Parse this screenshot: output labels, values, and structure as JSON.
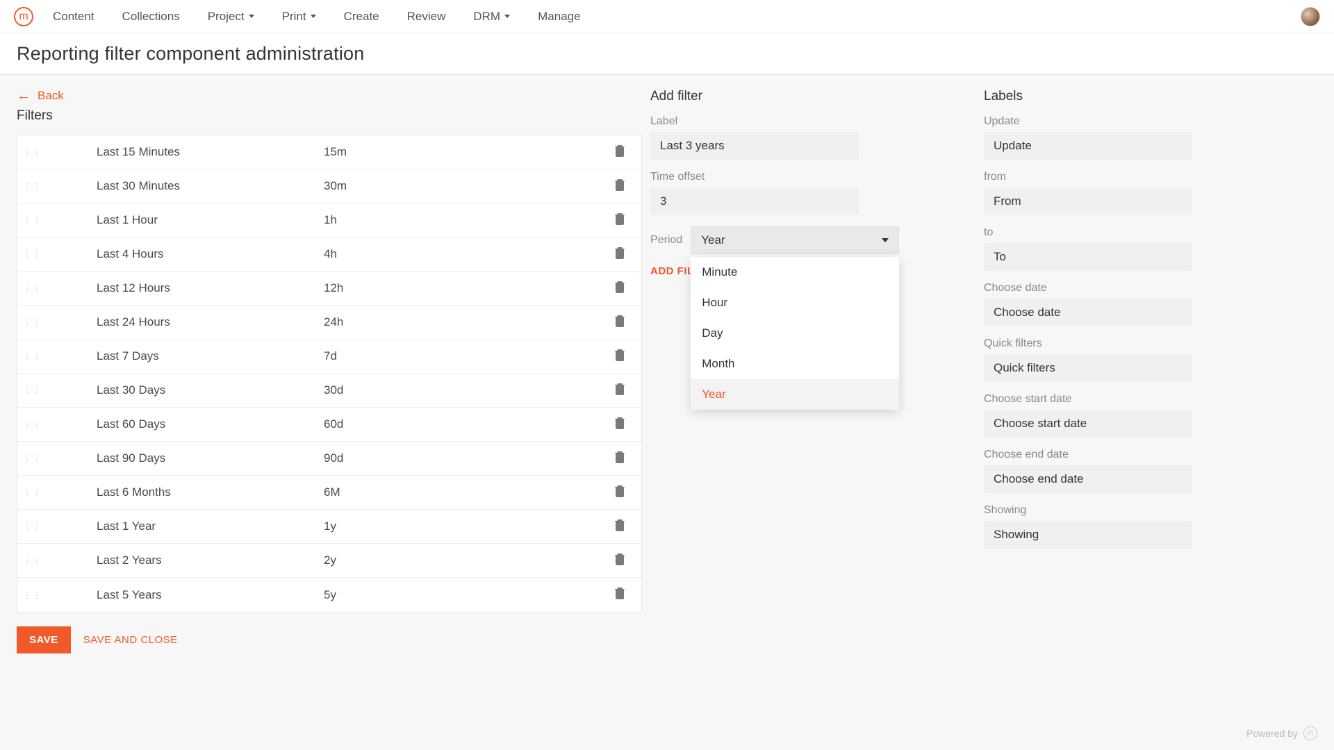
{
  "logo_letter": "m",
  "nav": [
    {
      "label": "Content",
      "caret": false
    },
    {
      "label": "Collections",
      "caret": false
    },
    {
      "label": "Project",
      "caret": true
    },
    {
      "label": "Print",
      "caret": true
    },
    {
      "label": "Create",
      "caret": false
    },
    {
      "label": "Review",
      "caret": false
    },
    {
      "label": "DRM",
      "caret": true
    },
    {
      "label": "Manage",
      "caret": false
    }
  ],
  "page_title": "Reporting filter component administration",
  "back_label": "Back",
  "filters_heading": "Filters",
  "filters": [
    {
      "label": "Last 15 Minutes",
      "code": "15m"
    },
    {
      "label": "Last 30 Minutes",
      "code": "30m"
    },
    {
      "label": "Last 1 Hour",
      "code": "1h"
    },
    {
      "label": "Last 4 Hours",
      "code": "4h"
    },
    {
      "label": "Last 12 Hours",
      "code": "12h"
    },
    {
      "label": "Last 24 Hours",
      "code": "24h"
    },
    {
      "label": "Last 7 Days",
      "code": "7d"
    },
    {
      "label": "Last 30 Days",
      "code": "30d"
    },
    {
      "label": "Last 60 Days",
      "code": "60d"
    },
    {
      "label": "Last 90 Days",
      "code": "90d"
    },
    {
      "label": "Last 6 Months",
      "code": "6M"
    },
    {
      "label": "Last 1 Year",
      "code": "1y"
    },
    {
      "label": "Last 2 Years",
      "code": "2y"
    },
    {
      "label": "Last 5 Years",
      "code": "5y"
    }
  ],
  "save_label": "SAVE",
  "save_close_label": "SAVE AND CLOSE",
  "add_filter": {
    "heading": "Add filter",
    "label_field": "Label",
    "label_value": "Last 3 years",
    "offset_field": "Time offset",
    "offset_value": "3",
    "period_field": "Period",
    "period_value": "Year",
    "period_options": [
      "Minute",
      "Hour",
      "Day",
      "Month",
      "Year"
    ],
    "add_btn": "ADD FILTER"
  },
  "labels": {
    "heading": "Labels",
    "items": [
      {
        "label": "Update",
        "value": "Update"
      },
      {
        "label": "from",
        "value": "From"
      },
      {
        "label": "to",
        "value": "To"
      },
      {
        "label": "Choose date",
        "value": "Choose date"
      },
      {
        "label": "Quick filters",
        "value": "Quick filters"
      },
      {
        "label": "Choose start date",
        "value": "Choose start date"
      },
      {
        "label": "Choose end date",
        "value": "Choose end date"
      },
      {
        "label": "Showing",
        "value": "Showing"
      }
    ]
  },
  "footer": "Powered by"
}
